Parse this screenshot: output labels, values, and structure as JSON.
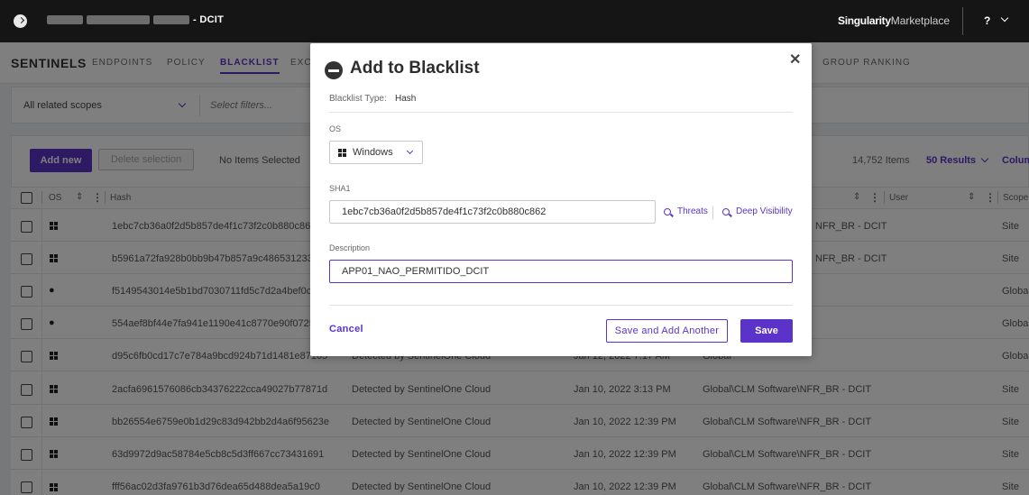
{
  "topbar": {
    "site_title": "- DCIT",
    "brand_bold": "Singularity",
    "brand_light": "Marketplace",
    "help": "?"
  },
  "nav": {
    "brand": "SENTINELS",
    "tabs": [
      "ENDPOINTS",
      "POLICY",
      "BLACKLIST",
      "EXC",
      "GROUP RANKING"
    ],
    "active_tab": "BLACKLIST"
  },
  "filter": {
    "scope": "All related scopes",
    "placeholder": "Select filters..."
  },
  "toolbar": {
    "add_new": "Add new",
    "delete_selection": "Delete selection",
    "no_items_selected": "No Items Selected",
    "items_count": "14,752 Items",
    "results": "50 Results",
    "columns": "Colum"
  },
  "table": {
    "headers": {
      "os": "OS",
      "hash": "Hash",
      "user": "User",
      "scope": "Scope"
    },
    "rows": [
      {
        "os": "windows",
        "hash": "1ebc7cb36a0f2d5b857de4f1c73f2c0b880c862",
        "source": "",
        "date": "",
        "scope_path": "NFR_BR - DCIT",
        "scope": "Site"
      },
      {
        "os": "windows",
        "hash": "b5961a72fa928b0bb9b47b857a9c486531233a",
        "source": "",
        "date": "",
        "scope_path": "NFR_BR - DCIT",
        "scope": "Site"
      },
      {
        "os": "apple",
        "hash": "f5149543014e5b1bd7030711fd5c7d2a4bef0c2",
        "source": "",
        "date": "",
        "scope_path": "",
        "scope": "Global"
      },
      {
        "os": "apple",
        "hash": "554aef8bf44e7fa941e1190e41c8770e90f0725",
        "source": "",
        "date": "",
        "scope_path": "",
        "scope": "Global"
      },
      {
        "os": "windows",
        "hash": "d95c6fb0cd17c7e784a9bcd924b71d1481e87105",
        "source": "Detected by SentinelOne Cloud",
        "date": "Jan 12, 2022 7:17 AM",
        "scope_path": "Global",
        "scope": "Global"
      },
      {
        "os": "windows",
        "hash": "2acfa6961576086cb34376222cca49027b77871d",
        "source": "Detected by SentinelOne Cloud",
        "date": "Jan 10, 2022 3:13 PM",
        "scope_path": "Global\\CLM Software\\NFR_BR - DCIT",
        "scope": "Site"
      },
      {
        "os": "windows",
        "hash": "bb26554e6759e0b1d29c83d942bb2d4a6f95623e",
        "source": "Detected by SentinelOne Cloud",
        "date": "Jan 10, 2022 12:39 PM",
        "scope_path": "Global\\CLM Software\\NFR_BR - DCIT",
        "scope": "Site"
      },
      {
        "os": "windows",
        "hash": "63d9972d9ac58784e5cb8c5d3ff667cc73431691",
        "source": "Detected by SentinelOne Cloud",
        "date": "Jan 10, 2022 12:39 PM",
        "scope_path": "Global\\CLM Software\\NFR_BR - DCIT",
        "scope": "Site"
      },
      {
        "os": "windows",
        "hash": "fff56ac02d3fa9761b3d76dea65d488dea5a19c0",
        "source": "Detected by SentinelOne Cloud",
        "date": "Jan 10, 2022 12:39 PM",
        "scope_path": "Global\\CLM Software\\NFR_BR - DCIT",
        "scope": "Site"
      }
    ]
  },
  "modal": {
    "title": "Add to Blacklist",
    "type_label": "Blacklist Type:",
    "type_value": "Hash",
    "os_label": "OS",
    "os_value": "Windows",
    "sha1_label": "SHA1",
    "sha1_value": "1ebc7cb36a0f2d5b857de4f1c73f2c0b880c862",
    "threats_link": "Threats",
    "deep_visibility_link": "Deep Visibility",
    "description_label": "Description",
    "description_value": "APP01_NAO_PERMITIDO_DCIT",
    "cancel": "Cancel",
    "save_and_add_another": "Save and Add Another",
    "save": "Save"
  },
  "colors": {
    "accent": "#5b33c9",
    "topbar": "#151515"
  }
}
